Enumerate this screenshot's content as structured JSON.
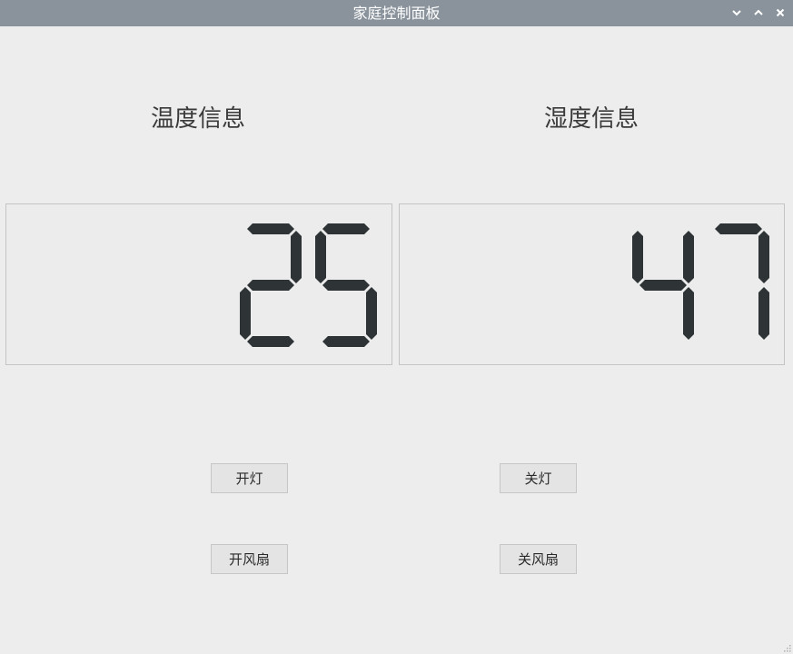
{
  "window": {
    "title": "家庭控制面板"
  },
  "temperature": {
    "heading": "温度信息",
    "value": "25"
  },
  "humidity": {
    "heading": "湿度信息",
    "value": "47"
  },
  "buttons": {
    "light_on": "开灯",
    "light_off": "关灯",
    "fan_on": "开风扇",
    "fan_off": "关风扇"
  },
  "colors": {
    "titlebar": "#8a939c",
    "lcd_segment": "#2e3436",
    "background": "#ededed"
  }
}
